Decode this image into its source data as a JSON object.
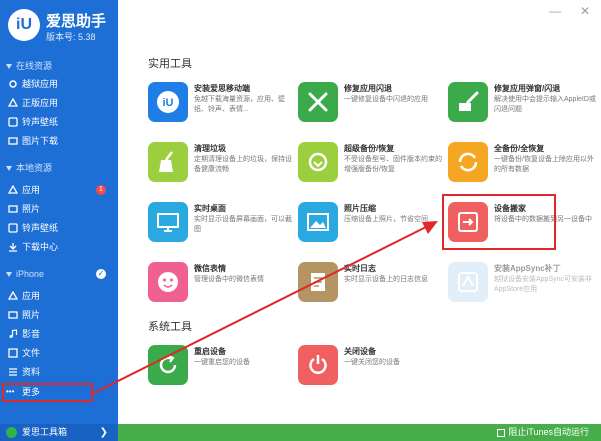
{
  "app": {
    "logo_mark": "iU",
    "title": "爱思助手",
    "version": "版本号: 5.38"
  },
  "window": {
    "min": "—",
    "close": "✕"
  },
  "sidebar": {
    "sections": [
      {
        "label": "在线资源"
      },
      {
        "label": "本地资源"
      },
      {
        "label": "iPhone"
      }
    ],
    "online": [
      {
        "label": "越狱应用",
        "icon": "gear-icon"
      },
      {
        "label": "正版应用",
        "icon": "apps-icon"
      },
      {
        "label": "铃声壁纸",
        "icon": "ringtone-icon"
      },
      {
        "label": "图片下载",
        "icon": "image-icon"
      }
    ],
    "local": [
      {
        "label": "应用",
        "icon": "apps-icon",
        "badge": "1"
      },
      {
        "label": "照片",
        "icon": "photo-icon"
      },
      {
        "label": "铃声壁纸",
        "icon": "ringtone-icon"
      },
      {
        "label": "下载中心",
        "icon": "download-icon"
      }
    ],
    "device": [
      {
        "label": "应用",
        "icon": "apps-icon"
      },
      {
        "label": "照片",
        "icon": "photo-icon"
      },
      {
        "label": "影音",
        "icon": "music-icon"
      },
      {
        "label": "文件",
        "icon": "folder-icon"
      },
      {
        "label": "资料",
        "icon": "list-icon"
      }
    ],
    "more": {
      "icon": "more-dots-icon",
      "label": "更多",
      "dots": "•••"
    },
    "toolbox": {
      "label": "爱思工具箱",
      "chevron": "❯"
    }
  },
  "content": {
    "practical_title": "实用工具",
    "system_title": "系统工具",
    "tools": [
      {
        "title": "安装爱思移动端",
        "desc": "免越下载海量资源，应用、壁纸、铃声、表情...",
        "color": "#1f7ee6",
        "icon": "iu-app-icon"
      },
      {
        "title": "修复应用闪退",
        "desc": "一键修复设备中闪退的应用",
        "color": "#3aaa4a",
        "icon": "repair-tools-icon"
      },
      {
        "title": "修复应用弹窗/闪退",
        "desc": "解决使用中会提示输入AppleID或闪退问题",
        "color": "#3aaa4a",
        "icon": "repair-popup-icon"
      },
      {
        "title": "清理垃圾",
        "desc": "定期清理设备上的垃圾，保持设备健康流畅",
        "color": "#9ccf3d",
        "icon": "broom-icon"
      },
      {
        "title": "超级备份/恢复",
        "desc": "不受设备型号、固件版本约束的增强版备份/恢复",
        "color": "#9ccf3d",
        "icon": "backup-icon"
      },
      {
        "title": "全备份/全恢复",
        "desc": "一键备份/恢复设备上除应用以外的所有数据",
        "color": "#f5a623",
        "icon": "sync-icon"
      },
      {
        "title": "实时桌面",
        "desc": "实时显示设备屏幕画面，可以截图",
        "color": "#2aa8e0",
        "icon": "monitor-icon"
      },
      {
        "title": "照片压缩",
        "desc": "压缩设备上照片，节省空间",
        "color": "#2aa8e0",
        "icon": "photo-compress-icon"
      },
      {
        "title": "设备搬家",
        "desc": "将设备中的数据搬到另一设备中",
        "color": "#f06060",
        "icon": "device-migrate-icon"
      },
      {
        "title": "微信表情",
        "desc": "管理设备中的微信表情",
        "color": "#f06090",
        "icon": "emoji-icon"
      },
      {
        "title": "实时日志",
        "desc": "实时显示设备上的日志信息",
        "color": "#b49463",
        "icon": "log-icon"
      },
      {
        "title": "安装AppSync补丁",
        "desc": "越狱设备安装AppSync可安装非AppStore应用",
        "color": "#c7dff2",
        "icon": "appsync-icon"
      }
    ],
    "system_tools": [
      {
        "title": "重启设备",
        "desc": "一键重启您的设备",
        "color": "#3aaa4a",
        "icon": "restart-icon"
      },
      {
        "title": "关闭设备",
        "desc": "一键关闭您的设备",
        "color": "#f06060",
        "icon": "power-icon"
      }
    ]
  },
  "statusbar": {
    "stop_itunes": "阻止iTunes自动运行"
  }
}
